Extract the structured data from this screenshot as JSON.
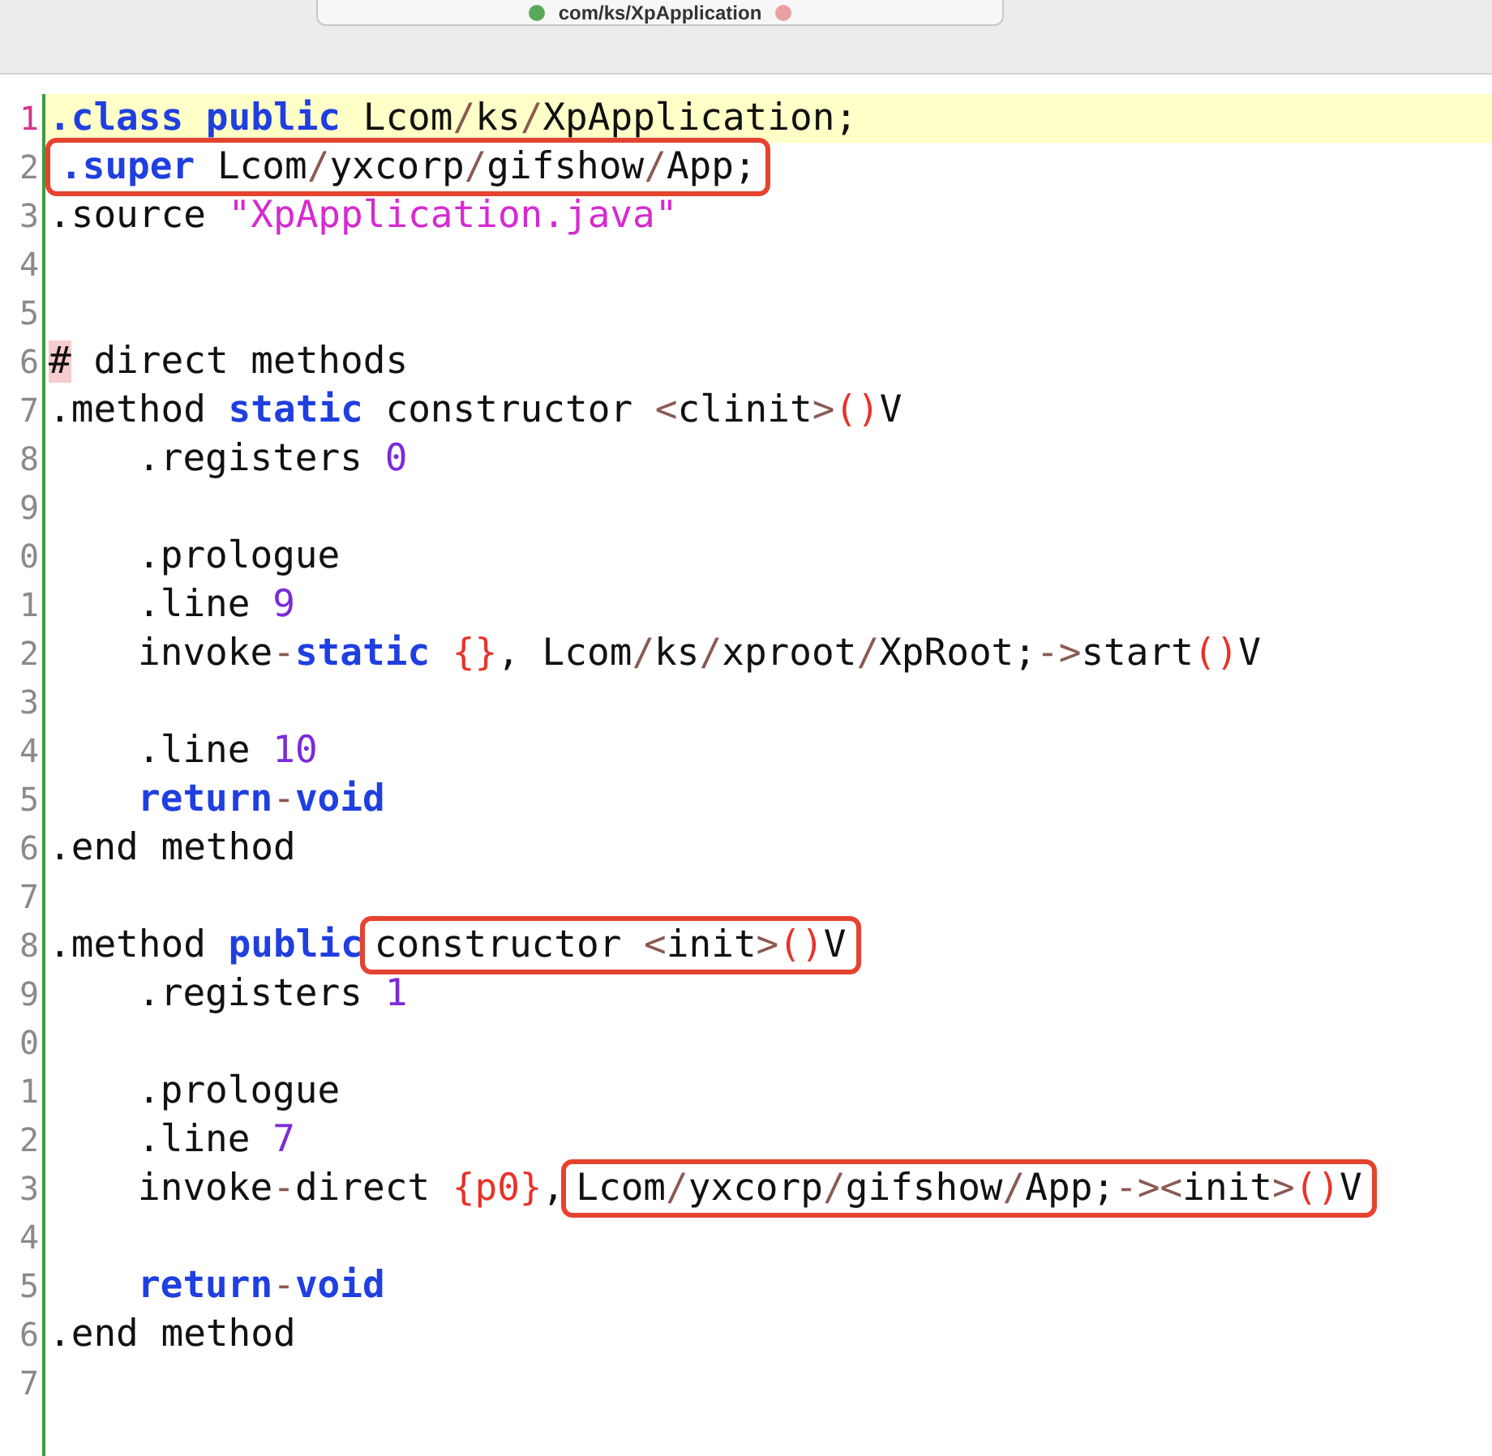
{
  "tab": {
    "label": "com/ks/XpApplication"
  },
  "lines": [
    {
      "number": "1",
      "highlighted": true,
      "indented": false,
      "segments": [
        {
          "boxed": false,
          "tokens": [
            {
              "kind": "keyword",
              "text": ".class public"
            },
            {
              "kind": "plain",
              "text": " Lcom"
            },
            {
              "kind": "sep",
              "text": "/"
            },
            {
              "kind": "plain",
              "text": "ks"
            },
            {
              "kind": "sep",
              "text": "/"
            },
            {
              "kind": "plain",
              "text": "XpApplication;"
            }
          ]
        }
      ]
    },
    {
      "number": "2",
      "highlighted": false,
      "indented": false,
      "segments": [
        {
          "boxed": true,
          "tokens": [
            {
              "kind": "keyword",
              "text": ".super"
            },
            {
              "kind": "plain",
              "text": " Lcom"
            },
            {
              "kind": "sep",
              "text": "/"
            },
            {
              "kind": "plain",
              "text": "yxcorp"
            },
            {
              "kind": "sep",
              "text": "/"
            },
            {
              "kind": "plain",
              "text": "gifshow"
            },
            {
              "kind": "sep",
              "text": "/"
            },
            {
              "kind": "plain",
              "text": "App;"
            }
          ]
        }
      ]
    },
    {
      "number": "3",
      "highlighted": false,
      "indented": false,
      "segments": [
        {
          "boxed": false,
          "tokens": [
            {
              "kind": "plain",
              "text": ".source "
            },
            {
              "kind": "string",
              "text": "\"XpApplication.java\""
            }
          ]
        }
      ]
    },
    {
      "number": "4",
      "highlighted": false
    },
    {
      "number": "5",
      "highlighted": false
    },
    {
      "number": "6",
      "highlighted": false,
      "indented": false,
      "segments": [
        {
          "boxed": false,
          "tokens": [
            {
              "kind": "marker",
              "text": "#"
            },
            {
              "kind": "plain",
              "text": " direct methods"
            }
          ]
        }
      ]
    },
    {
      "number": "7",
      "highlighted": false,
      "indented": false,
      "segments": [
        {
          "boxed": false,
          "tokens": [
            {
              "kind": "plain",
              "text": ".method "
            },
            {
              "kind": "keyword",
              "text": "static"
            },
            {
              "kind": "plain",
              "text": " constructor "
            },
            {
              "kind": "sep",
              "text": "<"
            },
            {
              "kind": "plain",
              "text": "clinit"
            },
            {
              "kind": "sep",
              "text": ">"
            },
            {
              "kind": "punct",
              "text": "()"
            },
            {
              "kind": "plain",
              "text": "V"
            }
          ]
        }
      ]
    },
    {
      "number": "8",
      "highlighted": false,
      "indented": true,
      "segments": [
        {
          "boxed": false,
          "tokens": [
            {
              "kind": "plain",
              "text": ".registers "
            },
            {
              "kind": "number",
              "text": "0"
            }
          ]
        }
      ]
    },
    {
      "number": "9",
      "highlighted": false
    },
    {
      "number": "0",
      "highlighted": false,
      "indented": true,
      "segments": [
        {
          "boxed": false,
          "tokens": [
            {
              "kind": "plain",
              "text": ".prologue"
            }
          ]
        }
      ]
    },
    {
      "number": "1",
      "highlighted": false,
      "indented": true,
      "segments": [
        {
          "boxed": false,
          "tokens": [
            {
              "kind": "plain",
              "text": ".line "
            },
            {
              "kind": "number",
              "text": "9"
            }
          ]
        }
      ]
    },
    {
      "number": "2",
      "highlighted": false,
      "indented": true,
      "segments": [
        {
          "boxed": false,
          "tokens": [
            {
              "kind": "plain",
              "text": "invoke"
            },
            {
              "kind": "sep",
              "text": "-"
            },
            {
              "kind": "keyword",
              "text": "static"
            },
            {
              "kind": "punct",
              "text": " {}"
            },
            {
              "kind": "plain",
              "text": ", Lcom"
            },
            {
              "kind": "sep",
              "text": "/"
            },
            {
              "kind": "plain",
              "text": "ks"
            },
            {
              "kind": "sep",
              "text": "/"
            },
            {
              "kind": "plain",
              "text": "xproot"
            },
            {
              "kind": "sep",
              "text": "/"
            },
            {
              "kind": "plain",
              "text": "XpRoot;"
            },
            {
              "kind": "sep",
              "text": "->"
            },
            {
              "kind": "plain",
              "text": "start"
            },
            {
              "kind": "punct",
              "text": "()"
            },
            {
              "kind": "plain",
              "text": "V"
            }
          ]
        }
      ]
    },
    {
      "number": "3",
      "highlighted": false
    },
    {
      "number": "4",
      "highlighted": false,
      "indented": true,
      "segments": [
        {
          "boxed": false,
          "tokens": [
            {
              "kind": "plain",
              "text": ".line "
            },
            {
              "kind": "number",
              "text": "10"
            }
          ]
        }
      ]
    },
    {
      "number": "5",
      "highlighted": false,
      "indented": true,
      "segments": [
        {
          "boxed": false,
          "tokens": [
            {
              "kind": "keyword",
              "text": "return"
            },
            {
              "kind": "sep",
              "text": "-"
            },
            {
              "kind": "keyword",
              "text": "void"
            }
          ]
        }
      ]
    },
    {
      "number": "6",
      "highlighted": false,
      "indented": false,
      "segments": [
        {
          "boxed": false,
          "tokens": [
            {
              "kind": "plain",
              "text": ".end method"
            }
          ]
        }
      ]
    },
    {
      "number": "7",
      "highlighted": false
    },
    {
      "number": "8",
      "highlighted": false,
      "indented": false,
      "segments": [
        {
          "boxed": false,
          "tokens": [
            {
              "kind": "plain",
              "text": ".method "
            },
            {
              "kind": "keyword",
              "text": "public"
            }
          ]
        },
        {
          "boxed": true,
          "tokens": [
            {
              "kind": "plain",
              "text": "constructor "
            },
            {
              "kind": "sep",
              "text": "<"
            },
            {
              "kind": "plain",
              "text": "init"
            },
            {
              "kind": "sep",
              "text": ">"
            },
            {
              "kind": "punct",
              "text": "()"
            },
            {
              "kind": "plain",
              "text": "V"
            }
          ]
        }
      ]
    },
    {
      "number": "9",
      "highlighted": false,
      "indented": true,
      "segments": [
        {
          "boxed": false,
          "tokens": [
            {
              "kind": "plain",
              "text": ".registers "
            },
            {
              "kind": "number",
              "text": "1"
            }
          ]
        }
      ]
    },
    {
      "number": "0",
      "highlighted": false
    },
    {
      "number": "1",
      "highlighted": false,
      "indented": true,
      "segments": [
        {
          "boxed": false,
          "tokens": [
            {
              "kind": "plain",
              "text": ".prologue"
            }
          ]
        }
      ]
    },
    {
      "number": "2",
      "highlighted": false,
      "indented": true,
      "segments": [
        {
          "boxed": false,
          "tokens": [
            {
              "kind": "plain",
              "text": ".line "
            },
            {
              "kind": "number",
              "text": "7"
            }
          ]
        }
      ]
    },
    {
      "number": "3",
      "highlighted": false,
      "indented": true,
      "segments": [
        {
          "boxed": false,
          "tokens": [
            {
              "kind": "plain",
              "text": "invoke"
            },
            {
              "kind": "sep",
              "text": "-"
            },
            {
              "kind": "plain",
              "text": "direct "
            },
            {
              "kind": "punct",
              "text": "{p0}"
            },
            {
              "kind": "plain",
              "text": ","
            }
          ]
        },
        {
          "boxed": true,
          "tokens": [
            {
              "kind": "plain",
              "text": "Lcom"
            },
            {
              "kind": "sep",
              "text": "/"
            },
            {
              "kind": "plain",
              "text": "yxcorp"
            },
            {
              "kind": "sep",
              "text": "/"
            },
            {
              "kind": "plain",
              "text": "gifshow"
            },
            {
              "kind": "sep",
              "text": "/"
            },
            {
              "kind": "plain",
              "text": "App;"
            },
            {
              "kind": "sep",
              "text": "->"
            },
            {
              "kind": "sep",
              "text": "<"
            },
            {
              "kind": "plain",
              "text": "init"
            },
            {
              "kind": "sep",
              "text": ">"
            },
            {
              "kind": "punct",
              "text": "()"
            },
            {
              "kind": "plain",
              "text": "V"
            }
          ]
        }
      ]
    },
    {
      "number": "4",
      "highlighted": false
    },
    {
      "number": "5",
      "highlighted": false,
      "indented": true,
      "segments": [
        {
          "boxed": false,
          "tokens": [
            {
              "kind": "keyword",
              "text": "return"
            },
            {
              "kind": "sep",
              "text": "-"
            },
            {
              "kind": "keyword",
              "text": "void"
            }
          ]
        }
      ]
    },
    {
      "number": "6",
      "highlighted": false,
      "indented": false,
      "segments": [
        {
          "boxed": false,
          "tokens": [
            {
              "kind": "plain",
              "text": ".end method"
            }
          ]
        }
      ]
    },
    {
      "number": "7",
      "highlighted": false
    }
  ]
}
